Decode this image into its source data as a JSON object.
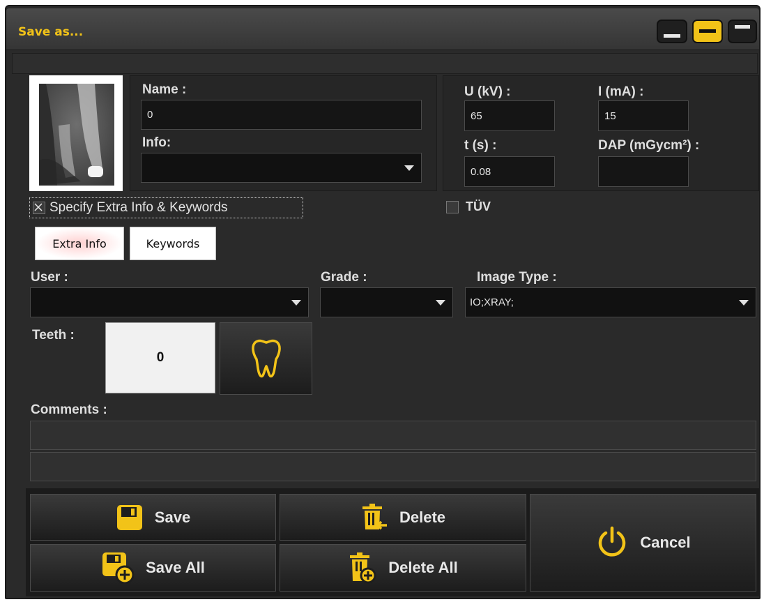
{
  "window": {
    "title": "Save as..."
  },
  "form": {
    "name_label": "Name :",
    "name_value": "0",
    "info_label": "Info:",
    "info_value": "",
    "specify_label": "Specify Extra Info & Keywords",
    "specify_checked": true,
    "tuv_label": "TÜV",
    "tuv_checked": false
  },
  "exposure": {
    "u_label": "U (kV) :",
    "u_value": "65",
    "i_label": "I (mA) :",
    "i_value": "15",
    "t_label": "t (s) :",
    "t_value": "0.08",
    "dap_label": "DAP (mGycm²) :",
    "dap_value": ""
  },
  "tabs": [
    {
      "label": "Extra Info",
      "active": true
    },
    {
      "label": "Keywords",
      "active": false
    }
  ],
  "extra": {
    "user_label": "User :",
    "user_value": "",
    "grade_label": "Grade :",
    "grade_value": "",
    "image_type_label": "Image Type :",
    "image_type_value": "IO;XRAY;",
    "teeth_label": "Teeth :",
    "teeth_value": "0",
    "comments_label": "Comments :",
    "comment_line1": "",
    "comment_line2": ""
  },
  "buttons": {
    "save": "Save",
    "delete": "Delete",
    "save_all": "Save All",
    "delete_all": "Delete All",
    "cancel": "Cancel"
  },
  "colors": {
    "accent": "#f2c318",
    "background": "#2a2a2a",
    "field": "#151515"
  },
  "icons": {
    "save": "floppy-disk-icon",
    "delete": "trash-arrow-icon",
    "save_all": "floppy-plus-icon",
    "delete_all": "trash-plus-icon",
    "cancel": "power-icon",
    "teeth": "tooth-icon"
  }
}
